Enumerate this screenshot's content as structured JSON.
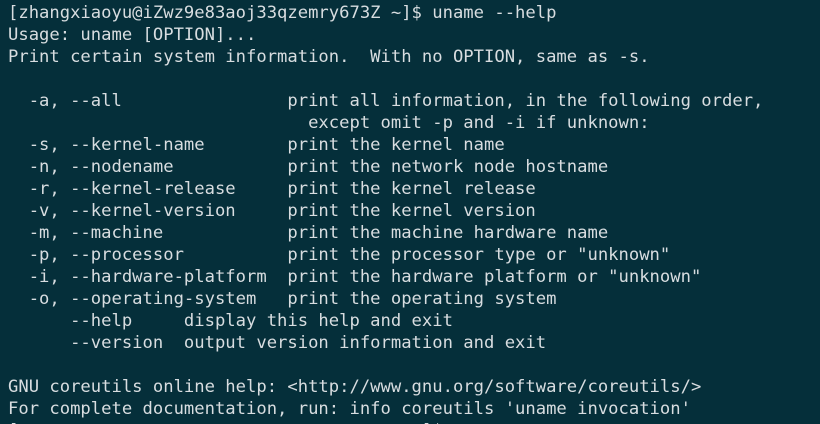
{
  "terminal": {
    "lines": [
      "[zhangxiaoyu@iZwz9e83aoj33qzemry673Z ~]$ uname --help",
      "Usage: uname [OPTION]...",
      "Print certain system information.  With no OPTION, same as -s.",
      "",
      "  -a, --all                print all information, in the following order,",
      "                             except omit -p and -i if unknown:",
      "  -s, --kernel-name        print the kernel name",
      "  -n, --nodename           print the network node hostname",
      "  -r, --kernel-release     print the kernel release",
      "  -v, --kernel-version     print the kernel version",
      "  -m, --machine            print the machine hardware name",
      "  -p, --processor          print the processor type or \"unknown\"",
      "  -i, --hardware-platform  print the hardware platform or \"unknown\"",
      "  -o, --operating-system   print the operating system",
      "      --help     display this help and exit",
      "      --version  output version information and exit",
      "",
      "GNU coreutils online help: <http://www.gnu.org/software/coreutils/>",
      "For complete documentation, run: info coreutils 'uname invocation'",
      "[                                      ~]$ "
    ]
  },
  "colors": {
    "background": "#052f3a",
    "text": "#d8dde0"
  }
}
